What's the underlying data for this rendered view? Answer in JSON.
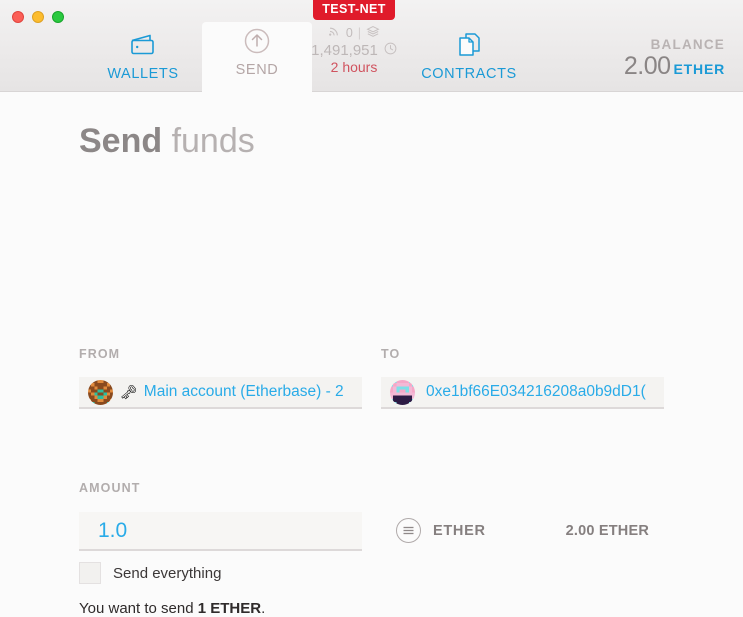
{
  "window": {
    "traffic_lights": [
      "close",
      "minimize",
      "zoom"
    ]
  },
  "header": {
    "tabs": [
      {
        "id": "wallets",
        "label": "WALLETS",
        "icon": "wallet-icon",
        "active": false
      },
      {
        "id": "send",
        "label": "SEND",
        "icon": "up-arrow-circle-icon",
        "active": true
      },
      {
        "id": "contracts",
        "label": "CONTRACTS",
        "icon": "documents-icon",
        "active": false
      }
    ],
    "network": {
      "badge": "TEST-NET",
      "badge_color": "#e01b2b",
      "peer_count": "0",
      "peer_icon": "signal-icon",
      "blocks_icon": "layers-icon",
      "divider": "|",
      "block_number": "1,491,951",
      "time_icon": "clock-icon",
      "time_since_block": "2 hours",
      "time_color": "#d0535f"
    },
    "balance": {
      "label": "BALANCE",
      "value": "2.00",
      "unit": "ETHER",
      "unit_color": "#1b9ad6"
    }
  },
  "main": {
    "title_strong": "Send",
    "title_rest": " funds",
    "from": {
      "label": "FROM",
      "avatar": "identicon-from",
      "key_glyph": "🗝",
      "account_text": "Main account (Etherbase) - 2",
      "text_color": "#29abe8"
    },
    "to": {
      "label": "TO",
      "avatar": "identicon-to",
      "address": "0xe1bf66E034216208a0b9dD1(",
      "text_color": "#29abe8"
    },
    "amount": {
      "label": "AMOUNT",
      "value": "1.0",
      "placeholder": "0.00",
      "value_color": "#29abe8",
      "unit_icon": "menu-circle-icon",
      "unit_name": "ETHER",
      "available_balance": "2.00 ETHER"
    },
    "send_everything": {
      "label": "Send everything",
      "checked": false
    },
    "summary": {
      "prefix": "You want to send ",
      "amount": "1 ETHER",
      "suffix": "."
    }
  }
}
